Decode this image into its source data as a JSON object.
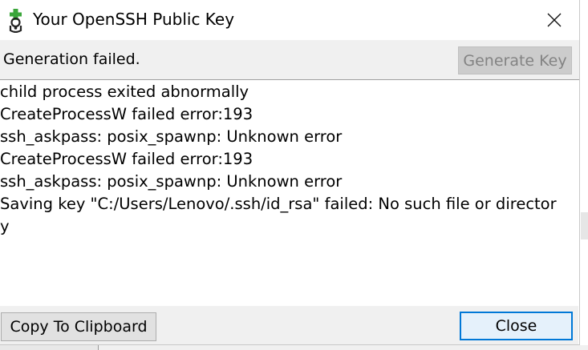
{
  "window": {
    "title": "Your OpenSSH Public Key"
  },
  "toolbar": {
    "status": "Generation failed.",
    "generate_label": "Generate Key"
  },
  "log": {
    "lines": [
      "child process exited abnormally",
      "CreateProcessW failed error:193",
      "ssh_askpass: posix_spawnp: Unknown error",
      "CreateProcessW failed error:193",
      "ssh_askpass: posix_spawnp: Unknown error",
      "Saving key \"C:/Users/Lenovo/.ssh/id_rsa\" failed: No such file or director",
      "y"
    ]
  },
  "footer": {
    "copy_label": "Copy To Clipboard",
    "close_label": "Close"
  },
  "icons": {
    "app": "git-key-icon",
    "close": "close-icon"
  }
}
